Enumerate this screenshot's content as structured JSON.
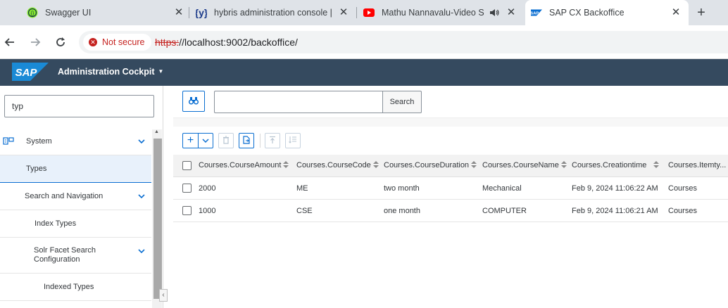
{
  "browser": {
    "tabs": [
      {
        "title": "Swagger UI",
        "icon": "swagger-icon",
        "color": "#85ea2d"
      },
      {
        "title": "hybris administration console | ",
        "icon": "hybris-icon",
        "color": "#1b3a8a"
      },
      {
        "title": "Mathu Nannavalu-Video So",
        "icon": "youtube-icon",
        "color": "#ff0000"
      },
      {
        "title": "SAP CX Backoffice",
        "icon": "sap-icon",
        "color": "#0a6ed1"
      }
    ],
    "close_glyph": "✕",
    "new_tab_glyph": "+",
    "security_label": "Not secure",
    "url_protocol": "https:",
    "url_rest": "//localhost:9002/backoffice/"
  },
  "header": {
    "logo_text": "SAP",
    "app_title": "Administration Cockpit",
    "brand_color": "#354a5f"
  },
  "sidebar": {
    "filter_value": "typ",
    "items": [
      {
        "label": "System",
        "expandable": true,
        "selected": false
      },
      {
        "label": "Types",
        "expandable": false,
        "selected": true
      },
      {
        "label": "Search and Navigation",
        "expandable": true,
        "selected": false
      },
      {
        "label": "Index Types",
        "expandable": false,
        "selected": false
      },
      {
        "label": "Solr Facet Search Configuration",
        "expandable": true,
        "selected": false
      },
      {
        "label": "Indexed Types",
        "expandable": false,
        "selected": false
      }
    ]
  },
  "search": {
    "value": "",
    "button_label": "Search"
  },
  "grid": {
    "columns": [
      "Courses.CourseAmount",
      "Courses.CourseCode",
      "Courses.CourseDuration",
      "Courses.CourseName",
      "Courses.Creationtime",
      "Courses.Itemty..."
    ],
    "rows": [
      [
        "2000",
        "ME",
        "two month",
        "Mechanical",
        "Feb 9, 2024 11:06:22 AM",
        "Courses"
      ],
      [
        "1000",
        "CSE",
        "one month",
        "COMPUTER",
        "Feb 9, 2024 11:06:21 AM",
        "Courses"
      ]
    ]
  }
}
